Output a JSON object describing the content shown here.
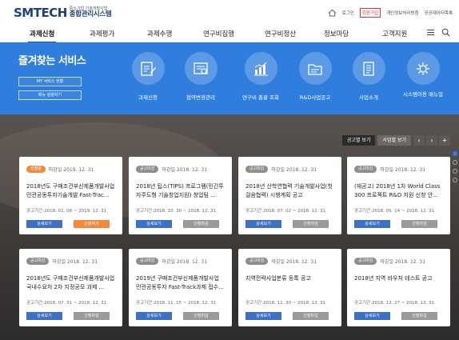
{
  "header": {
    "logo_main": "SMTECH",
    "logo_sub1": "중소기업 기술개발사업",
    "logo_sub2": "종합관리시스템",
    "util_links": [
      "로그인",
      "회원가입",
      "개인정보처리방침",
      "공공데이터목록"
    ]
  },
  "nav": {
    "items": [
      "과제신청",
      "과제평가",
      "과제수행",
      "연구비집행",
      "연구비정산",
      "정보마당",
      "고객지원"
    ],
    "active_index": 0
  },
  "favorites": {
    "title": "즐겨찾는 서비스",
    "my_services_button": "MY 서비스 현황",
    "menu_settings_button": "메뉴 설정하기",
    "services": [
      {
        "label": "과제신청",
        "icon": "edit-document-icon"
      },
      {
        "label": "협약변경관리",
        "icon": "contract-change-icon"
      },
      {
        "label": "연구비 총괄 조회",
        "icon": "bar-chart-icon"
      },
      {
        "label": "R&D사업공고",
        "icon": "announcement-folder-icon"
      },
      {
        "label": "사업소개",
        "icon": "document-list-icon"
      },
      {
        "label": "시스템이용 매뉴얼",
        "icon": "gear-manual-icon"
      }
    ]
  },
  "notice": {
    "tabs": [
      "공고별 보기",
      "사업별 보기"
    ],
    "active_tab": 0,
    "pager": {
      "prev": "‹",
      "next": "›",
      "add": "+"
    },
    "cards": [
      {
        "badge": "진행중",
        "badge_hot": true,
        "deadline": "마감일 2019. 12. 31",
        "title": "2018년도 구매조건부신제품개발사업 민관공동투자기술개발 Fast-Trac...",
        "period": "공고기간:2018. 01. 08 ~ 2019. 12. 31",
        "detail": "상세보기",
        "apply": "신청하기",
        "apply_active": true
      },
      {
        "badge": "공고마감",
        "badge_hot": false,
        "deadline": "마감일 2018. 12. 31",
        "title": "2018년 팁스(TIPS) 프로그램(민간투자주도형 기술창업지원) 창업팀 ...",
        "period": "공고기간:2018. 10. 30 ~ 2018. 12. 31",
        "detail": "상세보기",
        "apply": "신청마감",
        "apply_active": false
      },
      {
        "badge": "공고마감",
        "badge_hot": false,
        "deadline": "마감일 2018. 12. 31",
        "title": "2018년 산학연협력 기술개발사업(첫걸음협력) 시행계획 공고",
        "period": "공고기간:2018. 07. 02 ~ 2018. 12. 31",
        "detail": "상세보기",
        "apply": "신청마감",
        "apply_active": false
      },
      {
        "badge": "공고마감",
        "badge_hot": false,
        "deadline": "마감일 2018. 12. 31",
        "title": "(재공고) 2018년 1차 World Class 300 프로젝트 R&D 지원 신청 안...",
        "period": "공고기간:2018. 05. 14 ~ 2018. 12. 31",
        "detail": "상세보기",
        "apply": "신청마감",
        "apply_active": false
      },
      {
        "badge": "공고마감",
        "badge_hot": false,
        "deadline": "마감일 2018. 12. 31",
        "title": "2018년도 구매조건부신제품개발사업 국내수요처 2차 지정공모 과제 ...",
        "period": "공고기간:2018. 07. 31 ~ 2018. 12. 31",
        "detail": "상세보기",
        "apply": "신청마감",
        "apply_active": false
      },
      {
        "badge": "공고마감",
        "badge_hot": false,
        "deadline": "마감일 2018. 12. 31",
        "title": "2019년 구매조건부신제품개발사업 민관공동투자 Fast-Track과제 접수...",
        "period": "공고기간:2018. 11. 15 ~ 2018. 12. 31",
        "detail": "상세보기",
        "apply": "신청마감",
        "apply_active": false
      },
      {
        "badge": "공고마감",
        "badge_hot": false,
        "deadline": "마감일 2018. 12. 31",
        "title": "지역전략사업분류 등록 공고",
        "period": "공고기간:2018. 11. 30 ~ 2018. 12. 31",
        "detail": "상세보기",
        "apply": "신청마감",
        "apply_active": false
      },
      {
        "badge": "공고마감",
        "badge_hot": false,
        "deadline": "마감일 2018. 12. 31",
        "title": "2018년 지역 바우처 테스트 공고",
        "period": "공고기간:2018. 12. 27 ~ 2018. 12. 31",
        "detail": "상세보기",
        "apply": "신청마감",
        "apply_active": false
      }
    ]
  },
  "colors": {
    "brand_blue": "#2f7ede",
    "navy": "#1d3f7a",
    "orange": "#f08a3a",
    "red": "#e03030"
  }
}
